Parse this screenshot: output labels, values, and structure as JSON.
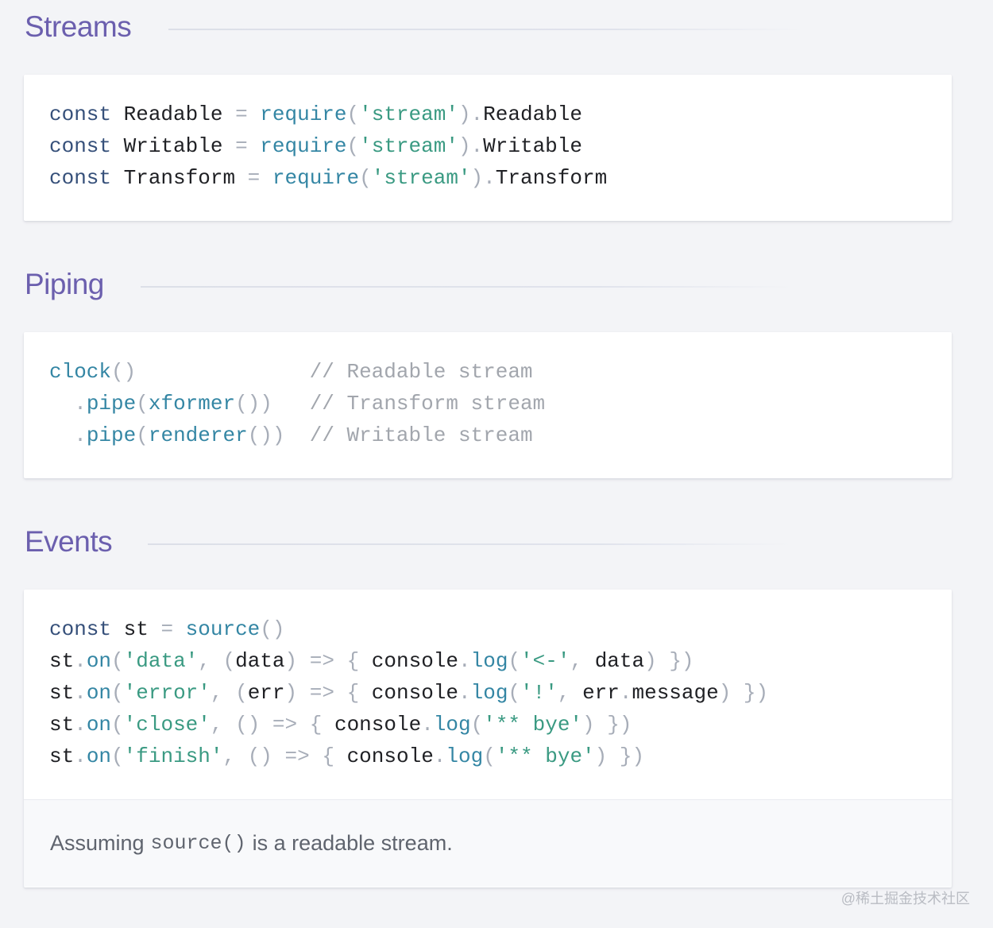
{
  "sections": {
    "streams": {
      "title": "Streams"
    },
    "piping": {
      "title": "Piping"
    },
    "events": {
      "title": "Events",
      "note_before": "Assuming",
      "note_code": "source()",
      "note_after": "is a readable stream."
    }
  },
  "watermark": "@稀土掘金技术社区"
}
